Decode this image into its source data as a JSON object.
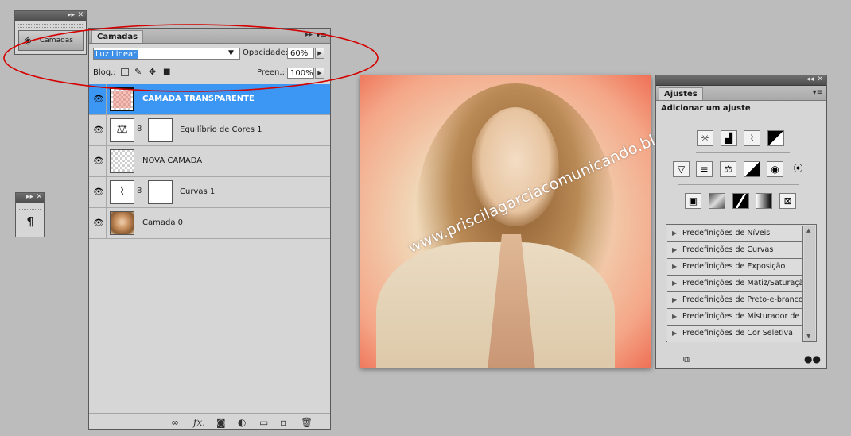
{
  "collapsed_panel": {
    "label": "Camadas"
  },
  "paragraph_panel": {
    "glyph": "¶"
  },
  "layers_panel": {
    "tab": "Camadas",
    "blend_mode": "Luz Linear",
    "opacity_label": "Opacidade:",
    "opacity_value": "60%",
    "lock_label": "Bloq.:",
    "fill_label": "Preen.:",
    "fill_value": "100%",
    "layers": [
      {
        "name": "CAMADA TRANSPARENTE",
        "selected": true
      },
      {
        "name": "Equilíbrio de Cores 1",
        "selected": false
      },
      {
        "name": "NOVA CAMADA",
        "selected": false
      },
      {
        "name": "Curvas 1",
        "selected": false
      },
      {
        "name": "Camada 0",
        "selected": false
      }
    ],
    "footer_icons": [
      "link-icon",
      "fx-icon",
      "mask-icon",
      "adjustment-icon",
      "folder-icon",
      "new-layer-icon",
      "trash-icon"
    ],
    "fx_glyph": "fx."
  },
  "photo": {
    "watermark": "www.priscilagarciacomunicando.blogspot.com"
  },
  "adjustments_panel": {
    "tab": "Ajustes",
    "heading": "Adicionar um ajuste",
    "presets": [
      "Predefinições de Níveis",
      "Predefinições de Curvas",
      "Predefinições de Exposição",
      "Predefinições de Matiz/Saturação",
      "Predefinições de Preto-e-branco",
      "Predefinições de Misturador de ...",
      "Predefinições de Cor Seletiva"
    ]
  },
  "colors": {
    "selection": "#3c97f4",
    "annotation": "#d40000",
    "panel_bg": "#d6d6d6",
    "workspace_bg": "#bcbcbc"
  }
}
